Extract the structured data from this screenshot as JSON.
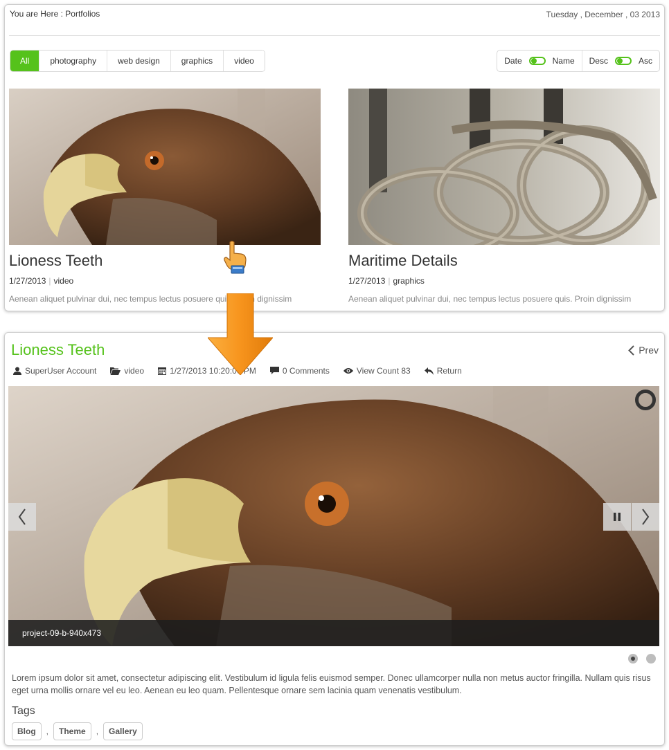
{
  "top": {
    "breadcrumb": "You are Here : Portfolios",
    "date": "Tuesday , December , 03 2013",
    "filters": [
      {
        "label": "All",
        "active": true
      },
      {
        "label": "photography",
        "active": false
      },
      {
        "label": "web design",
        "active": false
      },
      {
        "label": "graphics",
        "active": false
      },
      {
        "label": "video",
        "active": false
      }
    ],
    "sort": {
      "left_label": "Date",
      "right_label": "Name",
      "order_left": "Desc",
      "order_right": "Asc"
    },
    "cards": [
      {
        "title": "Lioness Teeth",
        "date": "1/27/2013",
        "category": "video",
        "excerpt": "Aenean aliquet pulvinar dui, nec tempus lectus posuere quis. Proin dignissim"
      },
      {
        "title": "Maritime Details",
        "date": "1/27/2013",
        "category": "graphics",
        "excerpt": "Aenean aliquet pulvinar dui, nec tempus lectus posuere quis. Proin dignissim"
      }
    ]
  },
  "detail": {
    "title": "Lioness Teeth",
    "prev_label": "Prev",
    "meta": {
      "author": "SuperUser Account",
      "category": "video",
      "datetime": "1/27/2013 10:20:00 PM",
      "comments": "0 Comments",
      "views": "View Count 83",
      "return": "Return"
    },
    "slide_caption": "project-09-b-940x473",
    "slides_total": 2,
    "slide_active": 1,
    "body": "Lorem ipsum dolor sit amet, consectetur adipiscing elit. Vestibulum id ligula felis euismod semper. Donec ullamcorper nulla non metus auctor fringilla. Nullam quis risus eget urna mollis ornare vel eu leo. Aenean eu leo quam. Pellentesque ornare sem lacinia quam venenatis vestibulum.",
    "tags_heading": "Tags",
    "tags": [
      "Blog",
      "Theme",
      "Gallery"
    ],
    "tag_separator": ","
  },
  "colors": {
    "accent": "#55c21b",
    "arrow": "#f7941d"
  }
}
